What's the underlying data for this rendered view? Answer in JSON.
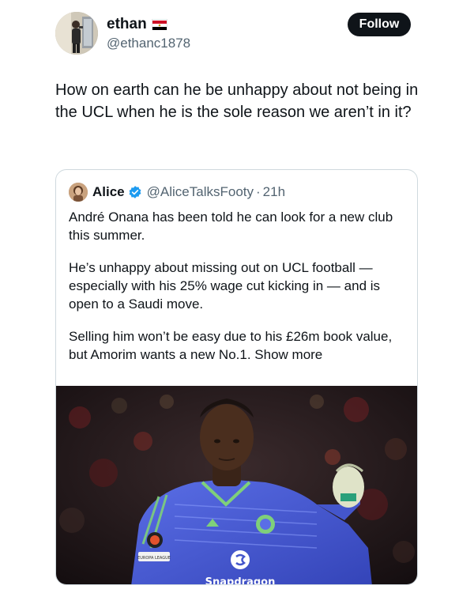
{
  "author": {
    "display_name": "ethan",
    "handle": "@ethanc1878",
    "flag_icon": "egypt-flag-icon"
  },
  "follow_button": {
    "label": "Follow"
  },
  "tweet": {
    "text": "How on earth can he be unhappy about not being in the UCL when he is the sole reason we aren’t in it?"
  },
  "quoted": {
    "display_name": "Alice",
    "verified_icon": "verified-badge-icon",
    "handle": "@AliceTalksFooty",
    "separator": "·",
    "time": "21h",
    "paragraphs": [
      "André Onana has been told he can look for a new club this summer.",
      "He’s unhappy about missing out on UCL football — especially with his 25% wage cut kicking in — and is open to a Saudi move."
    ],
    "last_paragraph": "Selling him won’t be easy due to his £26m book value, but Amorim wants a new No.1.",
    "show_more": "Show more",
    "image": {
      "sponsor_text": "Snapdragon",
      "badge_text": "EUROPA LEAGUE"
    }
  },
  "colors": {
    "text_primary": "#0f1419",
    "text_secondary": "#536471",
    "border": "#cfd9de",
    "verified": "#1d9bf0",
    "follow_bg": "#0f1419",
    "kit_blue": "#4a5fd1"
  }
}
